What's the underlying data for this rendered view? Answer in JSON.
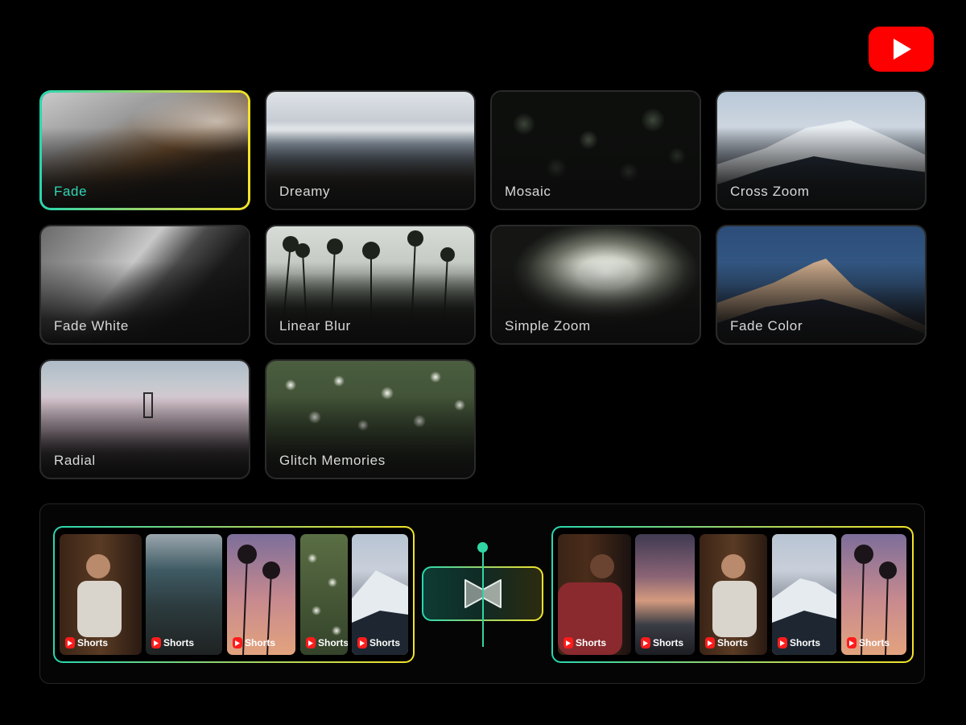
{
  "app": {
    "logo_icon": "youtube-logo-icon",
    "accent_gradient": [
      "#28d7b0",
      "#f2e32a"
    ],
    "selected_label_color": "#2fd6b6"
  },
  "transitions": [
    {
      "label": "Fade",
      "selected": true
    },
    {
      "label": "Dreamy",
      "selected": false
    },
    {
      "label": "Mosaic",
      "selected": false
    },
    {
      "label": "Cross Zoom",
      "selected": false
    },
    {
      "label": "Fade White",
      "selected": false
    },
    {
      "label": "Linear Blur",
      "selected": false
    },
    {
      "label": "Simple Zoom",
      "selected": false
    },
    {
      "label": "Fade Color",
      "selected": false
    },
    {
      "label": "Radial",
      "selected": false
    },
    {
      "label": "Glitch Memories",
      "selected": false
    }
  ],
  "timeline": {
    "transition_icon": "bowtie-transition-icon",
    "left_clips": [
      {
        "badge": "Shorts"
      },
      {
        "badge": "Shorts"
      },
      {
        "badge": "Shorts"
      },
      {
        "badge": "Shorts"
      },
      {
        "badge": "Shorts"
      }
    ],
    "right_clips": [
      {
        "badge": "Shorts"
      },
      {
        "badge": "Shorts"
      },
      {
        "badge": "Shorts"
      },
      {
        "badge": "Shorts"
      },
      {
        "badge": "Shorts"
      }
    ]
  }
}
